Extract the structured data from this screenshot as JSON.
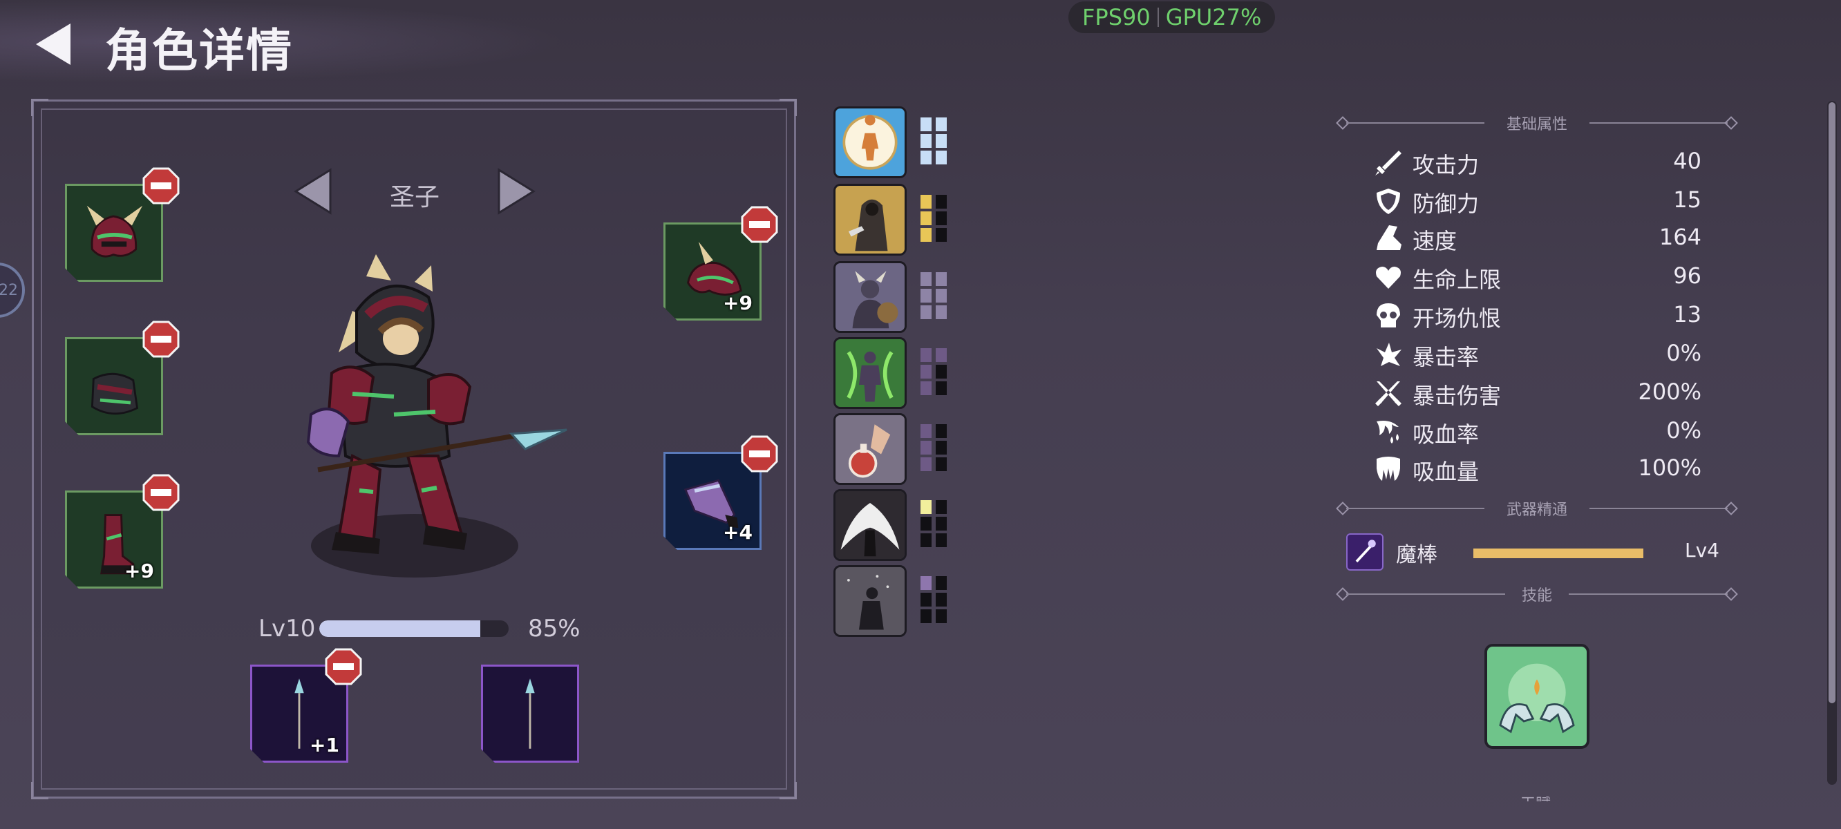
{
  "header": {
    "title": "角色详情"
  },
  "overlay": {
    "fps": "FPS90",
    "gpu": "GPU27%",
    "left_edge_badge": "22"
  },
  "character": {
    "name": "圣子",
    "level_label": "Lv10",
    "exp_fraction": 0.85,
    "exp_percent_label": "85%"
  },
  "equipment": {
    "left": [
      {
        "item": "helmet",
        "plus": ""
      },
      {
        "item": "armor",
        "plus": ""
      },
      {
        "item": "boots",
        "plus": "+9"
      }
    ],
    "right": [
      {
        "item": "shoulder",
        "plus": "+9"
      },
      {
        "item": "gauntlet",
        "plus": "+4"
      }
    ],
    "weapons": [
      {
        "item": "spear",
        "plus": "+1"
      },
      {
        "item": "spear",
        "plus": ""
      }
    ]
  },
  "traits": [
    {
      "icon": "radiant-body-icon",
      "pip_color": "#c8def6",
      "filled": 6
    },
    {
      "icon": "rogue-dagger-icon",
      "pip_color": "#e8c657",
      "filled": 3
    },
    {
      "icon": "horned-warrior-icon",
      "pip_color": "#8e84a6",
      "filled": 6
    },
    {
      "icon": "green-aura-figure-icon",
      "pip_color": "#6e5a86",
      "filled": 4
    },
    {
      "icon": "potion-flask-icon",
      "pip_color": "#6e5a86",
      "filled": 3
    },
    {
      "icon": "winged-figure-icon",
      "pip_color": "#f2ee9c",
      "filled": 1
    },
    {
      "icon": "shadow-figure-icon",
      "pip_color": "#8e76ad",
      "filled": 1
    }
  ],
  "basic_attributes": {
    "section_title": "基础属性",
    "stats": [
      {
        "icon": "sword-icon",
        "name": "攻击力",
        "value": "40"
      },
      {
        "icon": "shield-icon",
        "name": "防御力",
        "value": "15"
      },
      {
        "icon": "boot-icon",
        "name": "速度",
        "value": "164"
      },
      {
        "icon": "heart-icon",
        "name": "生命上限",
        "value": "96"
      },
      {
        "icon": "skull-icon",
        "name": "开场仇恨",
        "value": "13"
      },
      {
        "icon": "crit-burst-icon",
        "name": "暴击率",
        "value": "0%"
      },
      {
        "icon": "crossed-swords-icon",
        "name": "暴击伤害",
        "value": "200%"
      },
      {
        "icon": "drip-claw-icon",
        "name": "吸血率",
        "value": "0%"
      },
      {
        "icon": "fangs-icon",
        "name": "吸血量",
        "value": "100%"
      }
    ]
  },
  "weapon_mastery": {
    "section_title": "武器精通",
    "weapon_name": "魔棒",
    "progress": 1.0,
    "level": "Lv4"
  },
  "skills": {
    "section_title": "技能",
    "icon": "healing-hands-icon"
  },
  "colors": {
    "slot_green": "#1f3a26",
    "slot_blue": "#0f1e3e",
    "slot_purple": "#1d1238",
    "remove_red": "#c23a3a",
    "fps_green": "#6fd06d"
  }
}
